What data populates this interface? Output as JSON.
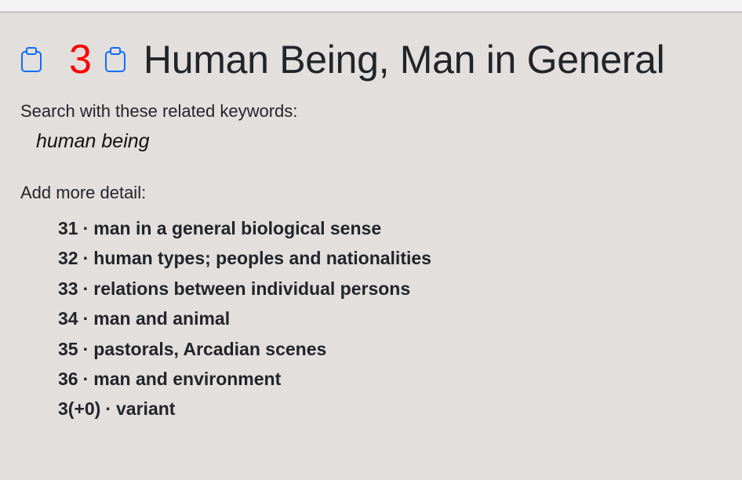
{
  "header": {
    "code": "3",
    "title": "Human Being, Man in General",
    "copy_icon": "clipboard-icon"
  },
  "keywords": {
    "label": "Search with these related keywords:",
    "items": [
      "human being"
    ]
  },
  "detail": {
    "label": "Add more detail:",
    "separator": "·",
    "items": [
      {
        "code": "31",
        "text": "man in a general biological sense"
      },
      {
        "code": "32",
        "text": "human types; peoples and nationalities"
      },
      {
        "code": "33",
        "text": "relations between individual persons"
      },
      {
        "code": "34",
        "text": "man and animal"
      },
      {
        "code": "35",
        "text": "pastorals, Arcadian scenes"
      },
      {
        "code": "36",
        "text": "man and environment"
      },
      {
        "code": "3(+0)",
        "text": "variant"
      }
    ]
  },
  "colors": {
    "background": "#e3dfdc",
    "code": "#ff0000",
    "icon": "#0d6efd",
    "text": "#212529"
  }
}
